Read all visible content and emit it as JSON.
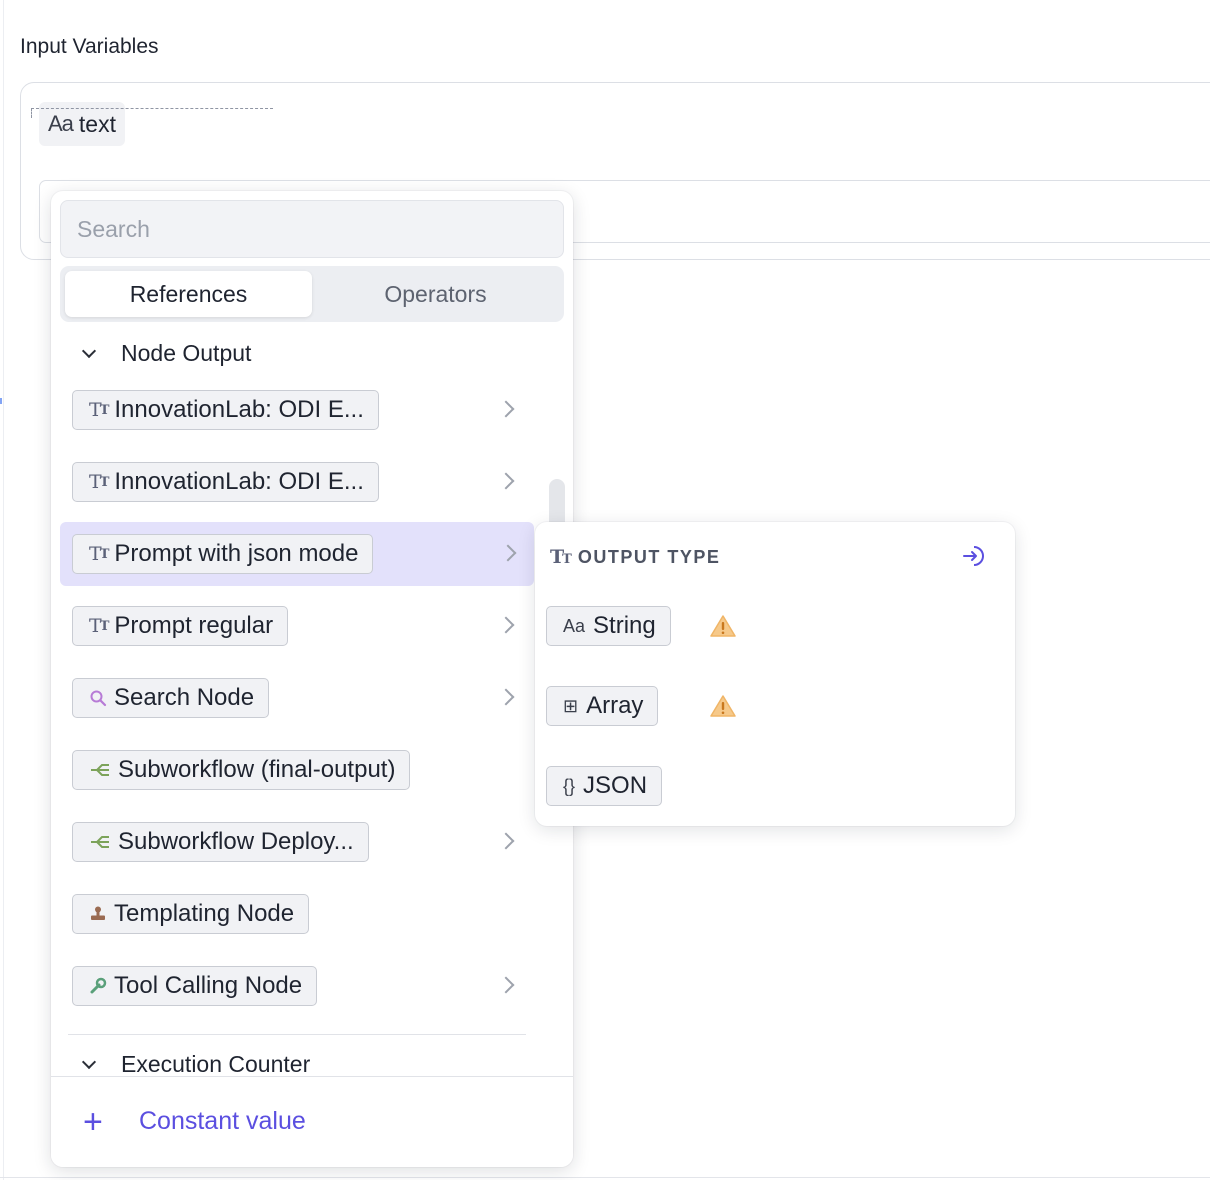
{
  "input_variables": {
    "title": "Input Variables",
    "variable": {
      "icon": "string-type-icon",
      "glyph": "Aa",
      "label": "text"
    }
  },
  "picker": {
    "search_placeholder": "Search",
    "tabs": [
      {
        "label": "References",
        "active": true
      },
      {
        "label": "Operators",
        "active": false
      }
    ],
    "node_output": {
      "label": "Node Output",
      "expanded": true,
      "items": [
        {
          "label": "InnovationLab: ODI E...",
          "icon": "text-type-icon",
          "has_submenu": true
        },
        {
          "label": "InnovationLab: ODI E...",
          "icon": "text-type-icon",
          "has_submenu": true
        },
        {
          "label": "Prompt with json mode",
          "icon": "text-type-icon",
          "has_submenu": true,
          "highlighted": true
        },
        {
          "label": "Prompt regular",
          "icon": "text-type-icon",
          "has_submenu": true
        },
        {
          "label": "Search Node",
          "icon": "search-icon",
          "has_submenu": true
        },
        {
          "label": "Subworkflow (final-output)",
          "icon": "subworkflow-icon",
          "has_submenu": false
        },
        {
          "label": "Subworkflow Deploy...",
          "icon": "subworkflow-icon",
          "has_submenu": true
        },
        {
          "label": "Templating Node",
          "icon": "stamp-icon",
          "has_submenu": false
        },
        {
          "label": "Tool Calling Node",
          "icon": "wrench-icon",
          "has_submenu": true
        }
      ]
    },
    "execution_counter": {
      "label": "Execution Counter",
      "expanded": true
    },
    "footer": {
      "plus": "+",
      "label": "Constant value"
    }
  },
  "output_type_menu": {
    "header": "OUTPUT TYPE",
    "types": [
      {
        "label": "String",
        "glyph": "Aa",
        "icon": "string-type-icon",
        "warning": true
      },
      {
        "label": "Array",
        "glyph": "⊞",
        "icon": "array-type-icon",
        "warning": true
      },
      {
        "label": "JSON",
        "glyph": "{}",
        "icon": "json-type-icon",
        "warning": false
      }
    ]
  },
  "colors": {
    "accent": "#5b4fe0",
    "highlight_row": "#e3e1fb",
    "warning": "#f2b35a"
  }
}
